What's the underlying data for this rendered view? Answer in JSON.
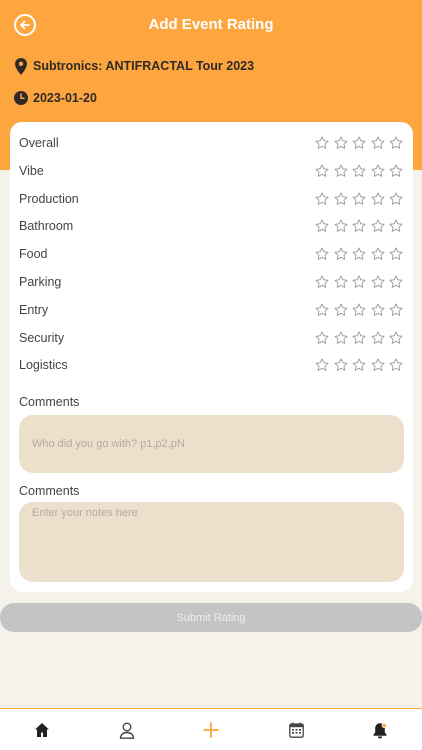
{
  "header": {
    "title": "Add Event Rating",
    "event_name": "Subtronics: ANTIFRACTAL Tour 2023",
    "event_date": "2023-01-20",
    "back_icon": "back-arrow-icon",
    "location_icon": "map-pin-icon",
    "clock_icon": "clock-icon"
  },
  "ratings": [
    {
      "label": "Overall",
      "stars": 0,
      "max": 5
    },
    {
      "label": "Vibe",
      "stars": 0,
      "max": 5
    },
    {
      "label": "Production",
      "stars": 0,
      "max": 5
    },
    {
      "label": "Bathroom",
      "stars": 0,
      "max": 5
    },
    {
      "label": "Food",
      "stars": 0,
      "max": 5
    },
    {
      "label": "Parking",
      "stars": 0,
      "max": 5
    },
    {
      "label": "Entry",
      "stars": 0,
      "max": 5
    },
    {
      "label": "Security",
      "stars": 0,
      "max": 5
    },
    {
      "label": "Logistics",
      "stars": 0,
      "max": 5
    }
  ],
  "companions": {
    "label": "Comments",
    "value": "",
    "placeholder": "Who did you go with? p1,p2,pN"
  },
  "notes": {
    "label": "Comments",
    "value": "",
    "placeholder": "Enter your notes here"
  },
  "submit_label": "Submit Rating",
  "nav": [
    {
      "name": "home",
      "icon": "home-icon",
      "active": true
    },
    {
      "name": "profile",
      "icon": "user-icon",
      "active": false
    },
    {
      "name": "add",
      "icon": "plus-icon",
      "active": false
    },
    {
      "name": "calendar",
      "icon": "calendar-icon",
      "active": false
    },
    {
      "name": "notifications",
      "icon": "bell-icon",
      "active": false
    }
  ],
  "colors": {
    "accent": "#fda63f",
    "background": "#f5f1eb",
    "field": "#ecdfcc",
    "disabled_button": "#c4c4c4"
  }
}
